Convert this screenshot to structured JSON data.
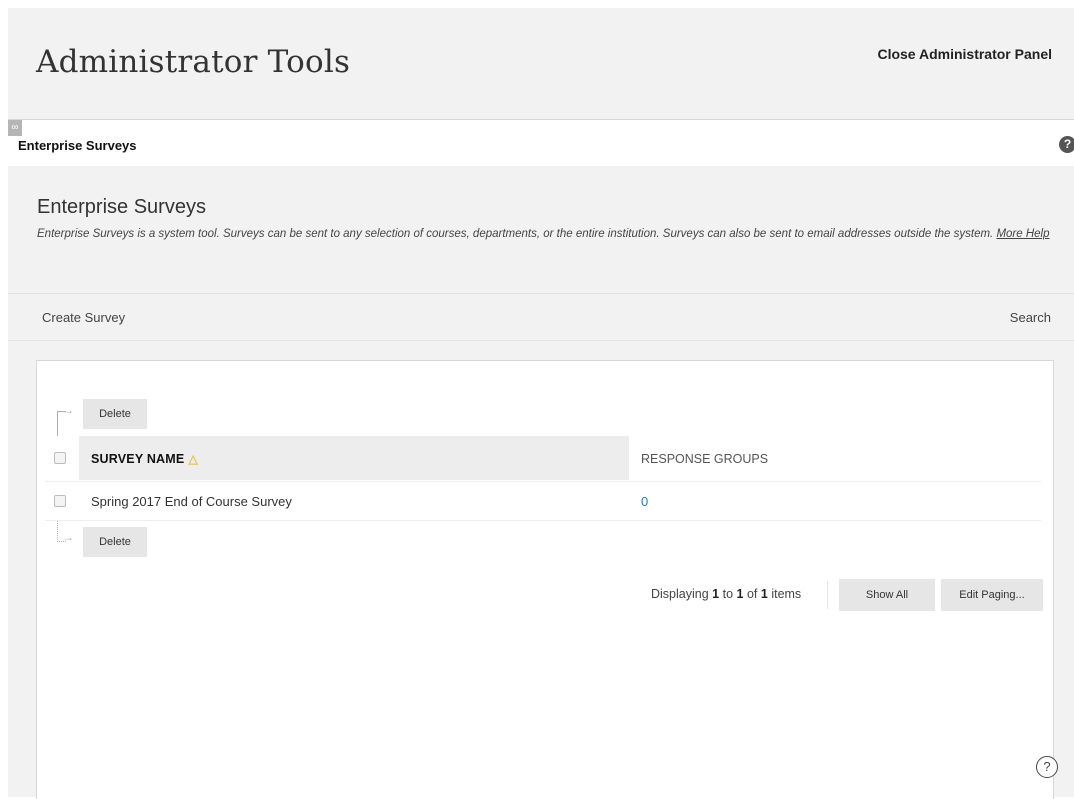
{
  "header": {
    "title": "Administrator Tools",
    "close_label": "Close Administrator Panel"
  },
  "breadcrumb": {
    "icon": "link-icon",
    "label": "Enterprise Surveys",
    "help_icon": "?"
  },
  "section": {
    "title": "Enterprise Surveys",
    "description": "Enterprise Surveys is a system tool. Surveys can be sent to any selection of courses, departments, or the entire institution. Surveys can also be sent to email addresses outside the system.",
    "help_link": "More Help"
  },
  "actions": {
    "create": "Create Survey",
    "search": "Search"
  },
  "table": {
    "delete_label": "Delete",
    "columns": {
      "name": "SURVEY NAME",
      "response_groups": "RESPONSE GROUPS"
    },
    "rows": [
      {
        "name": "Spring 2017 End of Course Survey",
        "response_groups": "0"
      }
    ]
  },
  "paging": {
    "prefix": "Displaying",
    "from": "1",
    "to_word": "to",
    "to": "1",
    "of_word": "of",
    "total": "1",
    "suffix": "items",
    "show_all": "Show All",
    "edit_paging": "Edit Paging..."
  },
  "floating_help": "?",
  "colors": {
    "link": "#2a79b8",
    "sort_indicator": "#e8c24a",
    "background": "#f2f2f2"
  }
}
